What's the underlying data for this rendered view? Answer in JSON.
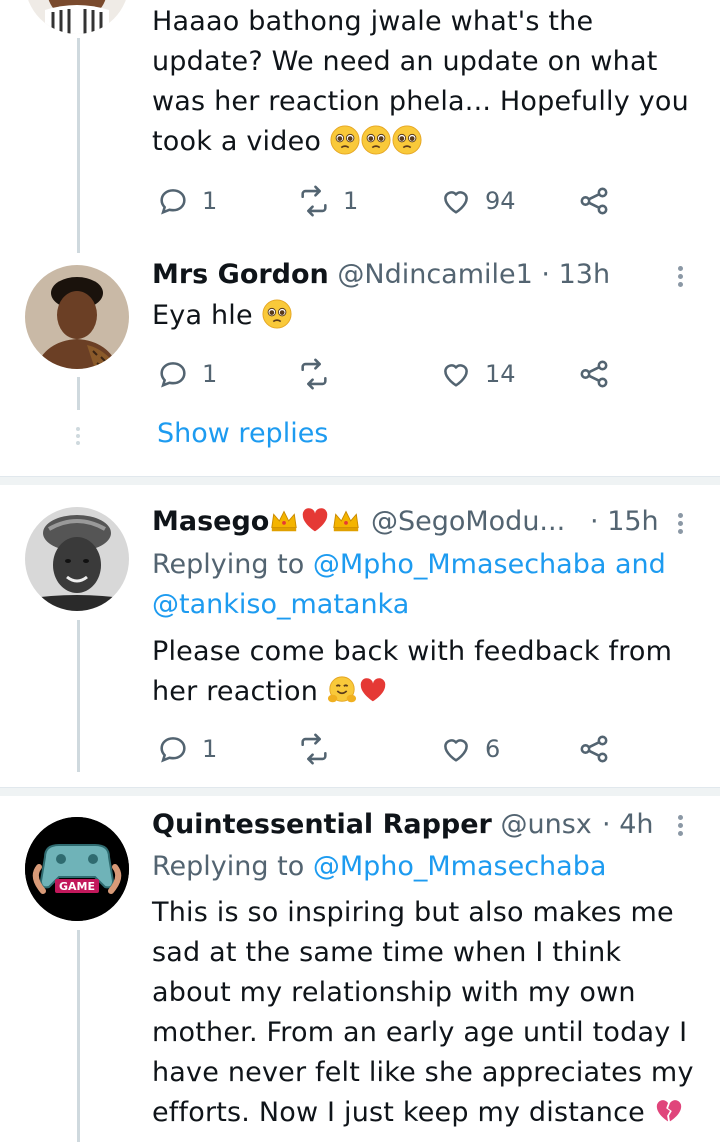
{
  "tweets": [
    {
      "text": "Haaao bathong jwale what's the update? We need an update on what was her reaction phela... Hopefully you took a video",
      "emojis": [
        "pleading-face-emoji",
        "pleading-face-emoji",
        "pleading-face-emoji"
      ],
      "actions": {
        "reply": "1",
        "retweet": "1",
        "like": "94",
        "share": ""
      }
    },
    {
      "name": "Mrs Gordon",
      "handle": "@Ndincamile1",
      "separator": "·",
      "time": "13h",
      "text": "Eya hle",
      "emojis": [
        "pleading-face-emoji"
      ],
      "actions": {
        "reply": "1",
        "retweet": "",
        "like": "14",
        "share": ""
      }
    },
    {
      "name": "Masego",
      "name_emojis": [
        "crown-emoji",
        "red-heart-emoji",
        "crown-emoji"
      ],
      "handle": "@SegoModu...",
      "separator": "·",
      "time": "15h",
      "replying_prefix": "Replying to",
      "replying_to_1": "@Mpho_Mmasechaba",
      "replying_and": "and",
      "replying_to_2": "@tankiso_matanka",
      "text": "Please come back with feedback from her reaction",
      "emojis": [
        "hugging-face-emoji",
        "red-heart-emoji"
      ],
      "actions": {
        "reply": "1",
        "retweet": "",
        "like": "6",
        "share": ""
      }
    },
    {
      "name": "Quintessential Rapper",
      "handle": "@unsx...",
      "separator": "·",
      "time": "4h",
      "replying_prefix": "Replying to",
      "replying_to_1": "@Mpho_Mmasechaba",
      "text": "This is so inspiring but also makes me sad at the same time when I think about my relationship with my own mother. From an early age until today I have never felt like she appreciates my efforts. Now I just keep my distance",
      "emojis": [
        "broken-heart-emoji"
      ]
    }
  ],
  "show_replies": "Show replies",
  "avatar_logo_text": "GAME",
  "colors": {
    "link": "#1d9bf0",
    "muted": "#536471",
    "thread": "#cfd9de"
  }
}
